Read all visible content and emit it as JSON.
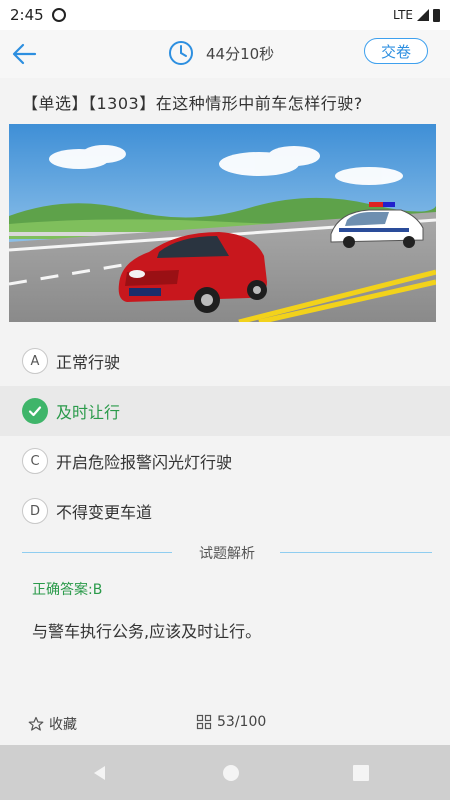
{
  "status_bar": {
    "time": "2:45",
    "network": "LTE"
  },
  "header": {
    "timer": "44分10秒",
    "submit_label": "交卷"
  },
  "question": {
    "text": "【单选】【1303】在这种情形中前车怎样行驶?"
  },
  "options": [
    {
      "letter": "A",
      "text": "正常行驶",
      "selected": false
    },
    {
      "letter": "B",
      "text": "及时让行",
      "selected": true
    },
    {
      "letter": "C",
      "text": "开启危险报警闪光灯行驶",
      "selected": false
    },
    {
      "letter": "D",
      "text": "不得变更车道",
      "selected": false
    }
  ],
  "analysis": {
    "title": "试题解析",
    "answer": "正确答案:B",
    "text": "与警车执行公务,应该及时让行。"
  },
  "footer": {
    "favorite_label": "收藏",
    "progress": "53/100"
  },
  "colors": {
    "accent": "#2d8fe0",
    "correct": "#3fb56a",
    "correct_text": "#2a9a4a"
  }
}
